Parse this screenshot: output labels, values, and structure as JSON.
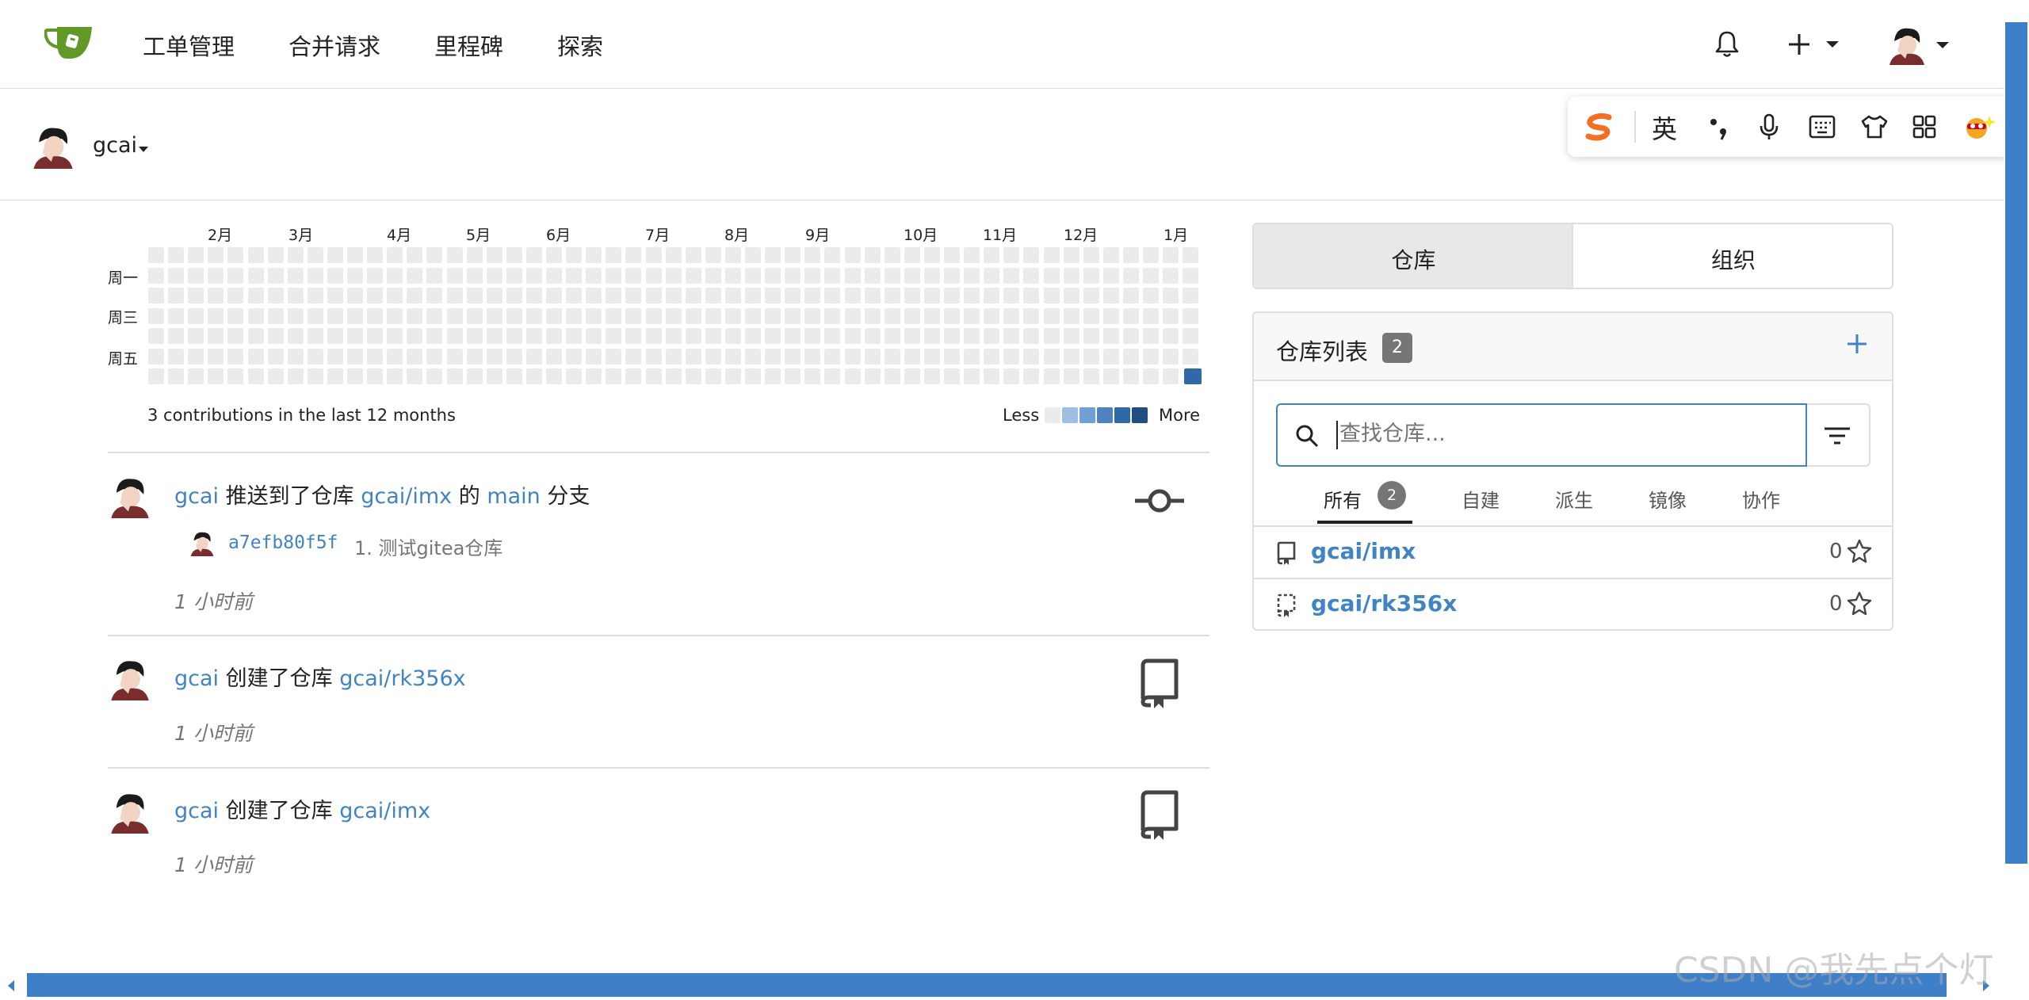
{
  "nav": {
    "items": [
      "工单管理",
      "合并请求",
      "里程碑",
      "探索"
    ]
  },
  "context": {
    "username": "gcai"
  },
  "ime": {
    "lang": "英"
  },
  "heatmap": {
    "months": [
      "2月",
      "3月",
      "4月",
      "5月",
      "6月",
      "7月",
      "8月",
      "9月",
      "10月",
      "11月",
      "12月",
      "1月"
    ],
    "weekdays": [
      "周一",
      "周三",
      "周五"
    ],
    "summary": "3 contributions in the last 12 months",
    "less": "Less",
    "more": "More"
  },
  "feed": {
    "item1": {
      "user": "gcai",
      "verb": "推送到了仓库",
      "repo": "gcai/imx",
      "of": "的",
      "branch": "main",
      "suffix": "分支",
      "sha": "a7efb80f5f",
      "msg": "1. 测试gitea仓库",
      "time": "1 小时前"
    },
    "item2": {
      "user": "gcai",
      "verb": "创建了仓库",
      "repo": "gcai/rk356x",
      "time": "1 小时前"
    },
    "item3": {
      "user": "gcai",
      "verb": "创建了仓库",
      "repo": "gcai/imx",
      "time": "1 小时前"
    }
  },
  "sidebar": {
    "tab_repos": "仓库",
    "tab_orgs": "组织",
    "title": "仓库列表",
    "count": "2",
    "search_placeholder": "查找仓库...",
    "filters": [
      {
        "label": "所有",
        "count": "2"
      },
      {
        "label": "自建"
      },
      {
        "label": "派生"
      },
      {
        "label": "镜像"
      },
      {
        "label": "协作"
      }
    ],
    "repos": [
      {
        "name": "gcai/imx",
        "stars": "0"
      },
      {
        "name": "gcai/rk356x",
        "stars": "0"
      }
    ]
  },
  "watermark": "CSDN @我先点个灯",
  "colors": {
    "link": "#4183c4",
    "heat_active": "#2f6aa6",
    "heat_empty": "#ebebeb",
    "scroll": "#3f7fc8"
  }
}
